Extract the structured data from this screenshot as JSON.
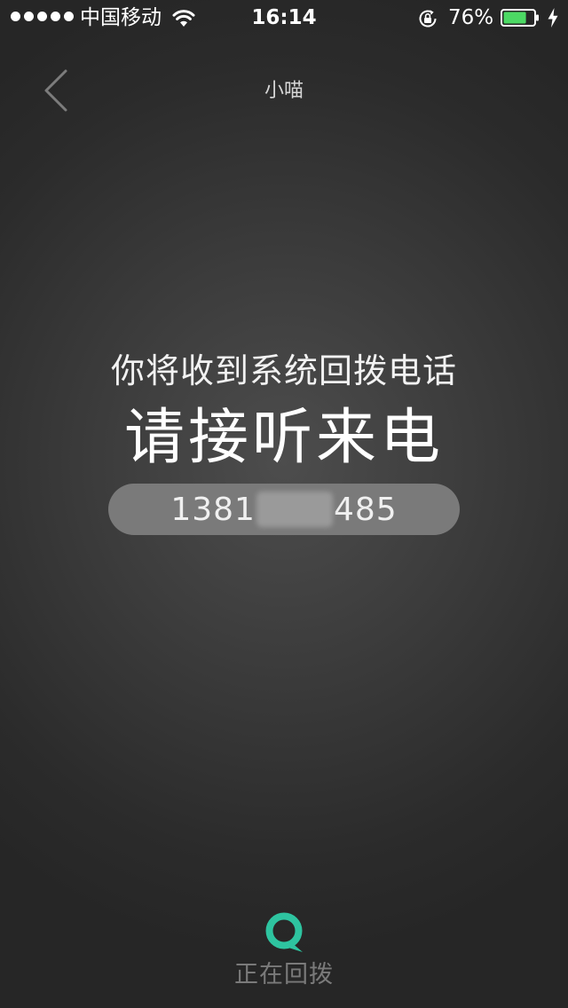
{
  "status_bar": {
    "carrier": "中国移动",
    "time": "16:14",
    "battery_percent": "76%",
    "battery_level": 0.76,
    "signal_bars": 5,
    "icons": [
      "wifi-icon",
      "rotation-lock-icon",
      "battery-icon",
      "charging-icon"
    ]
  },
  "nav": {
    "title": "小喵",
    "back_icon": "chevron-left-icon"
  },
  "main": {
    "subtitle": "你将收到系统回拨电话",
    "headline": "请接听来电",
    "phone": {
      "prefix": "1381",
      "suffix": "485"
    }
  },
  "footer": {
    "logo_icon": "app-logo-icon",
    "status_label": "正在回拨"
  },
  "colors": {
    "accent": "#2ec4a0",
    "battery_fill": "#4cd964"
  }
}
